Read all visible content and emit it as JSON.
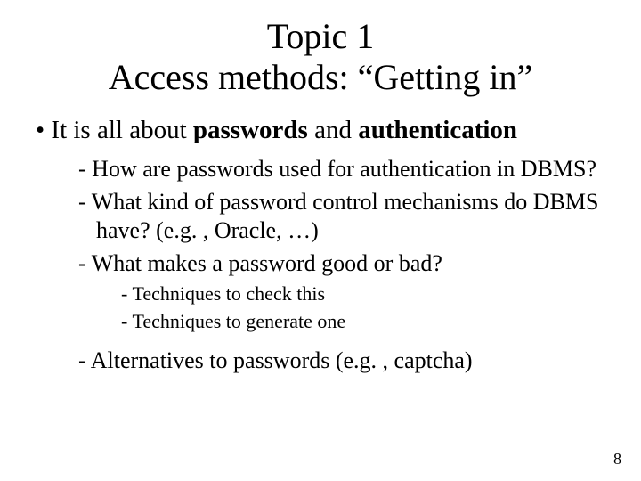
{
  "title_line1": "Topic 1",
  "title_line2": "Access methods: “Getting in”",
  "bullet1_pre": "It is all about ",
  "bullet1_b1": "passwords",
  "bullet1_mid": " and ",
  "bullet1_b2": "authentication",
  "sub1": "How are passwords used for authentication in DBMS?",
  "sub2": "What kind of password control mechanisms do DBMS have? (e.g. , Oracle, …)",
  "sub3": "What makes a password good or bad?",
  "subsub1": "Techniques to check this",
  "subsub2": "Techniques to generate one",
  "sub4": "Alternatives to passwords (e.g. , captcha)",
  "page_number": "8"
}
